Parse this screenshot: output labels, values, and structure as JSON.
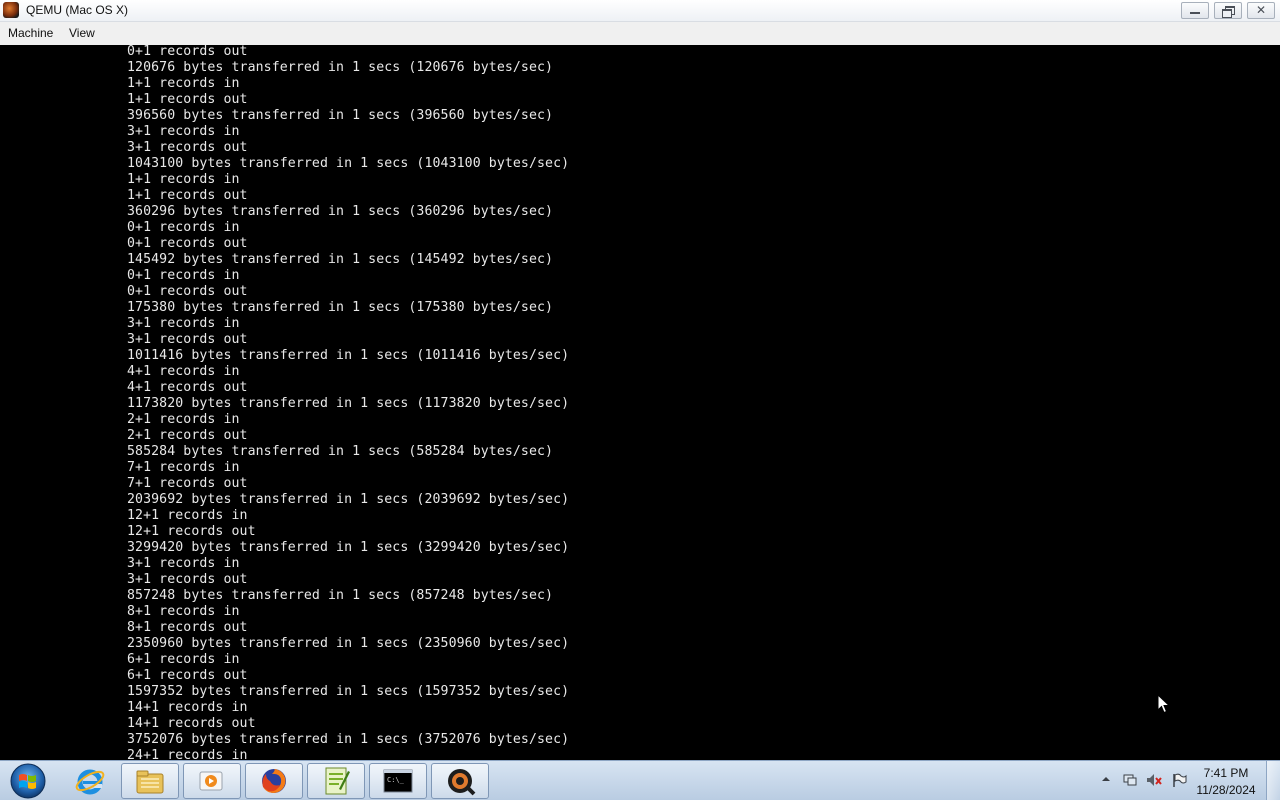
{
  "window": {
    "title": "QEMU (Mac OS X)",
    "close_glyph": "✕"
  },
  "menubar": {
    "items": [
      "Machine",
      "View"
    ]
  },
  "console": {
    "lines": [
      "0+1 records out",
      "120676 bytes transferred in 1 secs (120676 bytes/sec)",
      "1+1 records in",
      "1+1 records out",
      "396560 bytes transferred in 1 secs (396560 bytes/sec)",
      "3+1 records in",
      "3+1 records out",
      "1043100 bytes transferred in 1 secs (1043100 bytes/sec)",
      "1+1 records in",
      "1+1 records out",
      "360296 bytes transferred in 1 secs (360296 bytes/sec)",
      "0+1 records in",
      "0+1 records out",
      "145492 bytes transferred in 1 secs (145492 bytes/sec)",
      "0+1 records in",
      "0+1 records out",
      "175380 bytes transferred in 1 secs (175380 bytes/sec)",
      "3+1 records in",
      "3+1 records out",
      "1011416 bytes transferred in 1 secs (1011416 bytes/sec)",
      "4+1 records in",
      "4+1 records out",
      "1173820 bytes transferred in 1 secs (1173820 bytes/sec)",
      "2+1 records in",
      "2+1 records out",
      "585284 bytes transferred in 1 secs (585284 bytes/sec)",
      "7+1 records in",
      "7+1 records out",
      "2039692 bytes transferred in 1 secs (2039692 bytes/sec)",
      "12+1 records in",
      "12+1 records out",
      "3299420 bytes transferred in 1 secs (3299420 bytes/sec)",
      "3+1 records in",
      "3+1 records out",
      "857248 bytes transferred in 1 secs (857248 bytes/sec)",
      "8+1 records in",
      "8+1 records out",
      "2350960 bytes transferred in 1 secs (2350960 bytes/sec)",
      "6+1 records in",
      "6+1 records out",
      "1597352 bytes transferred in 1 secs (1597352 bytes/sec)",
      "14+1 records in",
      "14+1 records out",
      "3752076 bytes transferred in 1 secs (3752076 bytes/sec)",
      "24+1 records in"
    ]
  },
  "taskbar": {
    "start_icon": "windows-start-orb-icon",
    "apps": [
      {
        "name": "internet-explorer-icon",
        "active": false
      },
      {
        "name": "file-explorer-icon",
        "active": true
      },
      {
        "name": "media-player-icon",
        "active": true
      },
      {
        "name": "firefox-icon",
        "active": true
      },
      {
        "name": "notepad-plus-plus-icon",
        "active": true
      },
      {
        "name": "command-prompt-icon",
        "active": true
      },
      {
        "name": "qemu-icon",
        "active": true
      }
    ],
    "cmd_icon_text": "C:\\_",
    "tray_icons": [
      "show-hidden-icons-arrow-icon",
      "network-icon",
      "volume-muted-icon",
      "action-center-flag-icon"
    ],
    "clock": {
      "time": "7:41 PM",
      "date": "11/28/2024"
    }
  },
  "colors": {
    "console_bg": "#000000",
    "console_fg": "#e8e8e8",
    "taskbar_top": "#d7e4f2",
    "taskbar_bottom": "#b9cce2"
  }
}
